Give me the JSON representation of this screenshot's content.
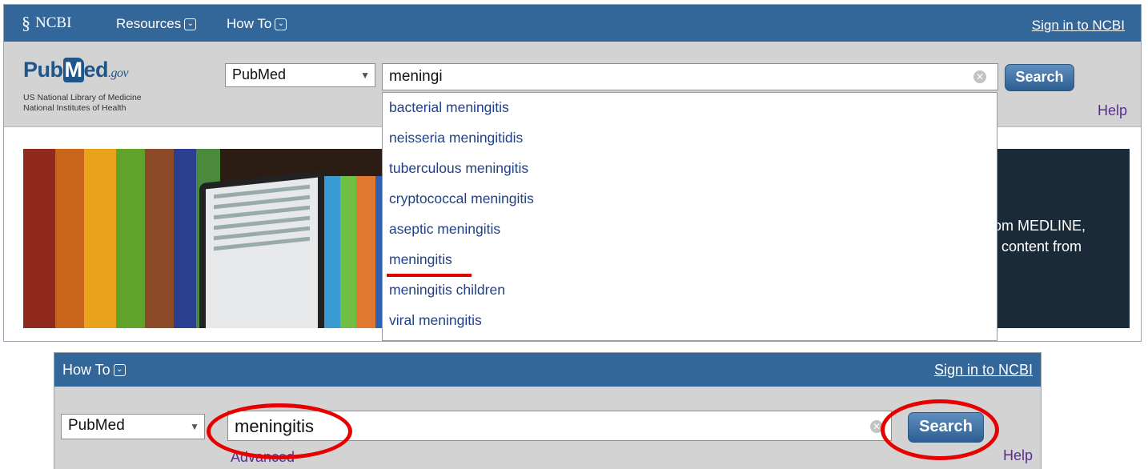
{
  "top": {
    "ncbi_label": "NCBI",
    "resources_label": "Resources",
    "howto_label": "How To",
    "signin_label": "Sign in to NCBI",
    "logo_main": "Pub",
    "logo_m": "M",
    "logo_rest": "ed",
    "logo_gov": ".gov",
    "nlm_line1": "US National Library of Medicine",
    "nlm_line2": "National Institutes of Health",
    "db_selected": "PubMed",
    "query_value": "meningi",
    "search_label": "Search",
    "help_label": "Help",
    "banner_line1": "om MEDLINE,",
    "banner_line2": "t content from",
    "suggestions": [
      "bacterial meningitis",
      "neisseria meningitidis",
      "tuberculous meningitis",
      "cryptococcal meningitis",
      "aseptic meningitis",
      "meningitis",
      "meningitis children",
      "viral meningitis"
    ]
  },
  "bottom": {
    "howto_label": "How To",
    "signin_label": "Sign in to NCBI",
    "db_selected": "PubMed",
    "query_value": "meningitis",
    "search_label": "Search",
    "advanced_label": "Advanced",
    "help_label": "Help"
  },
  "colors": {
    "header_blue": "#336699",
    "link_purple": "#5a2d8f",
    "annotation_red": "#e80000"
  }
}
